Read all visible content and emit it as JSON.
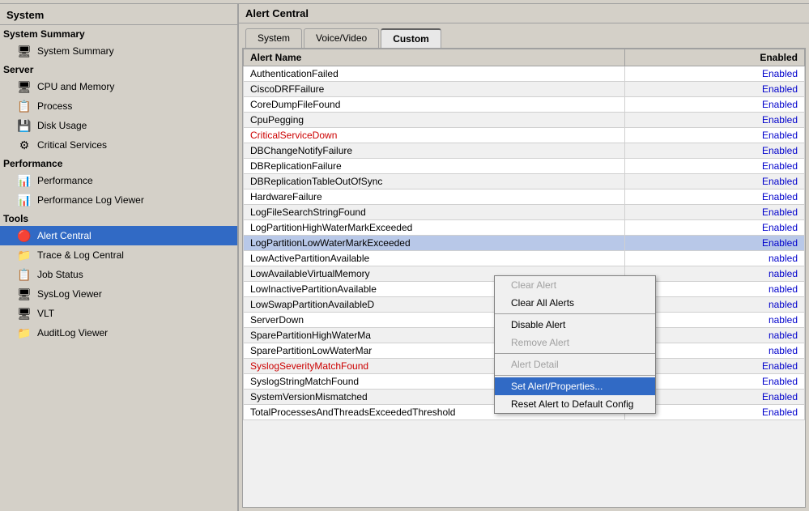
{
  "app": {
    "title": "Alert Central"
  },
  "sidebar": {
    "title": "System",
    "sections": [
      {
        "label": "System Summary",
        "items": [
          {
            "id": "system-summary",
            "label": "System Summary",
            "icon": "🖥",
            "active": false
          }
        ]
      },
      {
        "label": "Server",
        "items": [
          {
            "id": "cpu-memory",
            "label": "CPU and Memory",
            "icon": "🖥",
            "active": false
          },
          {
            "id": "process",
            "label": "Process",
            "icon": "📋",
            "active": false
          },
          {
            "id": "disk-usage",
            "label": "Disk Usage",
            "icon": "💾",
            "active": false
          },
          {
            "id": "critical-services",
            "label": "Critical Services",
            "icon": "⚙",
            "active": false
          }
        ]
      },
      {
        "label": "Performance",
        "items": [
          {
            "id": "performance",
            "label": "Performance",
            "icon": "📊",
            "active": false
          },
          {
            "id": "performance-log",
            "label": "Performance Log Viewer",
            "icon": "📊",
            "active": false
          }
        ]
      },
      {
        "label": "Tools",
        "items": [
          {
            "id": "alert-central",
            "label": "Alert Central",
            "icon": "🔴",
            "active": true
          },
          {
            "id": "trace-log",
            "label": "Trace & Log Central",
            "icon": "📁",
            "active": false
          },
          {
            "id": "job-status",
            "label": "Job Status",
            "icon": "📋",
            "active": false
          },
          {
            "id": "syslog-viewer",
            "label": "SysLog Viewer",
            "icon": "🖥",
            "active": false
          },
          {
            "id": "vlt",
            "label": "VLT",
            "icon": "🖥",
            "active": false
          },
          {
            "id": "auditlog-viewer",
            "label": "AuditLog Viewer",
            "icon": "📁",
            "active": false
          }
        ]
      }
    ]
  },
  "tabs": [
    {
      "id": "system",
      "label": "System",
      "active": false
    },
    {
      "id": "voice-video",
      "label": "Voice/Video",
      "active": false
    },
    {
      "id": "custom",
      "label": "Custom",
      "active": true
    }
  ],
  "table": {
    "headers": [
      {
        "id": "alert-name",
        "label": "Alert Name"
      },
      {
        "id": "enabled",
        "label": "Enabled"
      }
    ],
    "rows": [
      {
        "name": "AuthenticationFailed",
        "enabled": "Enabled",
        "highlight": false,
        "red": false
      },
      {
        "name": "CiscoDRFFailure",
        "enabled": "Enabled",
        "highlight": false,
        "red": false
      },
      {
        "name": "CoreDumpFileFound",
        "enabled": "Enabled",
        "highlight": false,
        "red": false
      },
      {
        "name": "CpuPegging",
        "enabled": "Enabled",
        "highlight": false,
        "red": false
      },
      {
        "name": "CriticalServiceDown",
        "enabled": "Enabled",
        "highlight": false,
        "red": true
      },
      {
        "name": "DBChangeNotifyFailure",
        "enabled": "Enabled",
        "highlight": false,
        "red": false
      },
      {
        "name": "DBReplicationFailure",
        "enabled": "Enabled",
        "highlight": false,
        "red": false
      },
      {
        "name": "DBReplicationTableOutOfSync",
        "enabled": "Enabled",
        "highlight": false,
        "red": false
      },
      {
        "name": "HardwareFailure",
        "enabled": "Enabled",
        "highlight": false,
        "red": false
      },
      {
        "name": "LogFileSearchStringFound",
        "enabled": "Enabled",
        "highlight": false,
        "red": false
      },
      {
        "name": "LogPartitionHighWaterMarkExceeded",
        "enabled": "Enabled",
        "highlight": false,
        "red": false
      },
      {
        "name": "LogPartitionLowWaterMarkExceeded",
        "enabled": "Enabled",
        "highlight": true,
        "red": false
      },
      {
        "name": "LowActivePartitionAvailable",
        "enabled": "Enabled",
        "highlight": false,
        "red": false,
        "partial": true
      },
      {
        "name": "LowAvailableVirtualMemory",
        "enabled": "Enabled",
        "highlight": false,
        "red": false,
        "partial": true
      },
      {
        "name": "LowInactivePartitionAvailable",
        "enabled": "Enabled",
        "highlight": false,
        "red": false,
        "partial": true
      },
      {
        "name": "LowSwapPartitionAvailableD",
        "enabled": "Enabled",
        "highlight": false,
        "red": false,
        "partial": true
      },
      {
        "name": "ServerDown",
        "enabled": "Enabled",
        "highlight": false,
        "red": false,
        "partial": true
      },
      {
        "name": "SparePartitionHighWaterMa",
        "enabled": "Enabled",
        "highlight": false,
        "red": false,
        "partial": true
      },
      {
        "name": "SparePartitionLowWaterMar",
        "enabled": "Enabled",
        "highlight": false,
        "red": false,
        "partial": true
      },
      {
        "name": "SyslogSeverityMatchFound",
        "enabled": "Enabled",
        "highlight": false,
        "red": true
      },
      {
        "name": "SyslogStringMatchFound",
        "enabled": "Enabled",
        "highlight": false,
        "red": false
      },
      {
        "name": "SystemVersionMismatched",
        "enabled": "Enabled",
        "highlight": false,
        "red": false
      },
      {
        "name": "TotalProcessesAndThreadsExceededThreshold",
        "enabled": "Enabled",
        "highlight": false,
        "red": false
      }
    ]
  },
  "context_menu": {
    "items": [
      {
        "id": "clear-alert",
        "label": "Clear Alert",
        "disabled": true,
        "active": false
      },
      {
        "id": "clear-all-alerts",
        "label": "Clear All Alerts",
        "disabled": false,
        "active": false
      },
      {
        "id": "separator1",
        "type": "separator"
      },
      {
        "id": "disable-alert",
        "label": "Disable Alert",
        "disabled": false,
        "active": false
      },
      {
        "id": "remove-alert",
        "label": "Remove Alert",
        "disabled": true,
        "active": false
      },
      {
        "id": "separator2",
        "type": "separator"
      },
      {
        "id": "alert-detail",
        "label": "Alert Detail",
        "disabled": true,
        "active": false
      },
      {
        "id": "separator3",
        "type": "separator"
      },
      {
        "id": "set-alert-properties",
        "label": "Set Alert/Properties...",
        "disabled": false,
        "active": true
      },
      {
        "id": "reset-alert",
        "label": "Reset Alert to Default Config",
        "disabled": false,
        "active": false
      }
    ]
  }
}
